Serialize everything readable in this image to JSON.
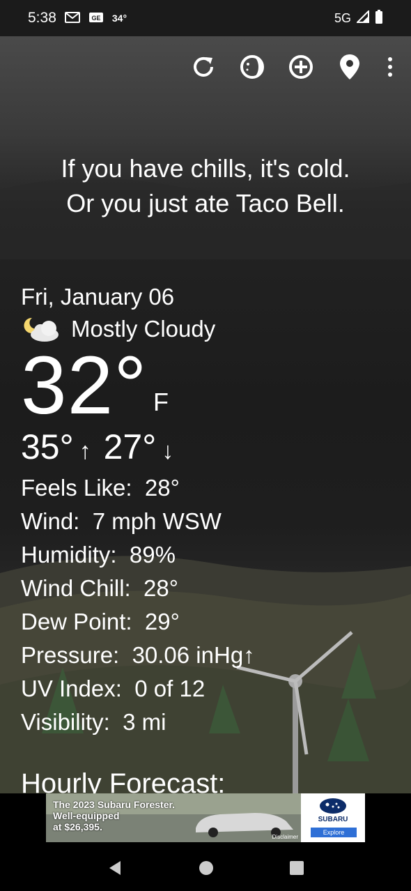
{
  "status": {
    "time": "5:38",
    "icon_gmail": "M",
    "icon_ge": "GE",
    "temp": "34°",
    "network": "5G"
  },
  "toolbar": {
    "refresh_icon": "refresh-icon",
    "theme_icon": "theme-icon",
    "add_icon": "add-location-icon",
    "location_icon": "location-pin-icon",
    "more_icon": "more-vert-icon"
  },
  "quote": {
    "line1": "If you have chills, it's cold.",
    "line2": "Or you just ate Taco Bell."
  },
  "weather": {
    "date": "Fri, January 06",
    "condition": "Mostly Cloudy",
    "temperature": "32°",
    "unit": "F",
    "high": "35°",
    "low": "27°",
    "high_arrow": "↑",
    "low_arrow": "↓"
  },
  "stats": [
    {
      "label": "Feels Like:",
      "value": "28°"
    },
    {
      "label": "Wind:",
      "value": "7 mph WSW"
    },
    {
      "label": "Humidity:",
      "value": "89%"
    },
    {
      "label": "Wind Chill:",
      "value": "28°"
    },
    {
      "label": "Dew Point:",
      "value": "29°"
    },
    {
      "label": "Pressure:",
      "value": "30.06 inHg↑"
    },
    {
      "label": "UV Index:",
      "value": "0 of 12"
    },
    {
      "label": "Visibility:",
      "value": "3 mi"
    }
  ],
  "hourly_title": "Hourly Forecast:",
  "ad": {
    "line1": "The 2023 Subaru Forester.",
    "line2": "Well-equipped",
    "line3": "at $26,395.",
    "brand": "SUBARU",
    "cta": "Explore",
    "disclaimer": "Disclaimer"
  },
  "nav": {
    "back_icon": "back-icon",
    "home_icon": "home-icon",
    "recents_icon": "recents-icon"
  }
}
